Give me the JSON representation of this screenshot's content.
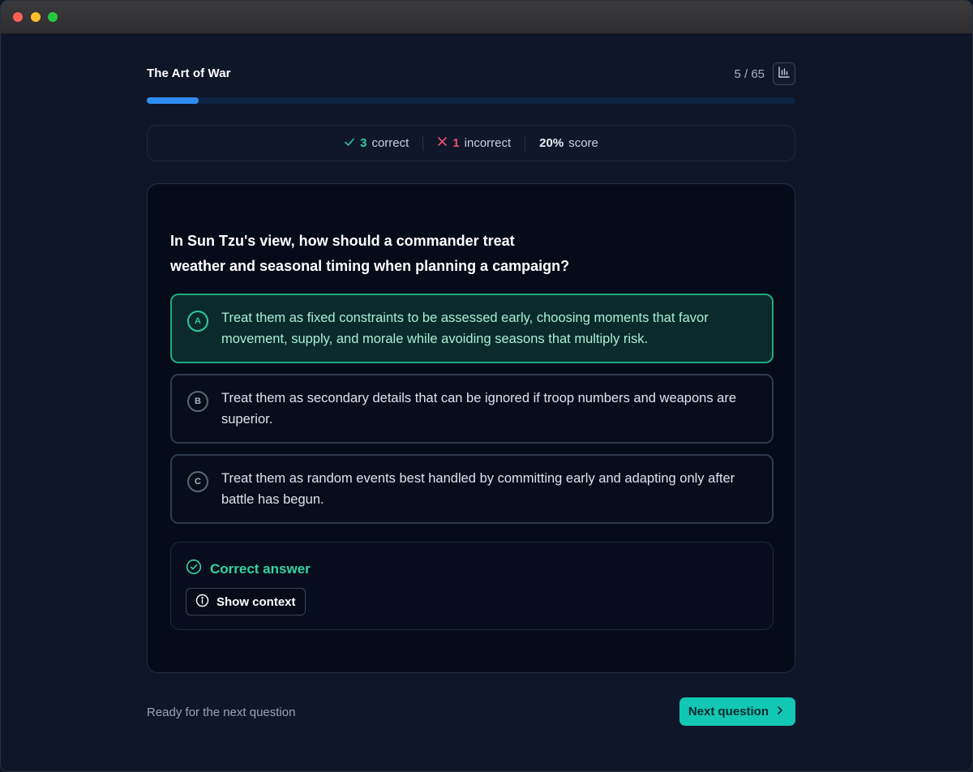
{
  "quiz": {
    "title": "The Art of War",
    "progress_text": "5 / 65",
    "progress_fraction": 0.08
  },
  "stats": {
    "correct_count": "3",
    "correct_label": "correct",
    "incorrect_count": "1",
    "incorrect_label": "incorrect",
    "score_value": "20%",
    "score_label": "score"
  },
  "question": {
    "text_line1": "In Sun Tzu's view, how should a commander treat",
    "text_line2": "weather and seasonal timing when planning a campaign?"
  },
  "options": [
    {
      "letter": "A",
      "text": "Treat them as fixed constraints to be assessed early, choosing moments that favor movement, supply, and morale while avoiding seasons that multiply risk.",
      "state": "correct"
    },
    {
      "letter": "B",
      "text": "Treat them as secondary details that can be ignored if troop numbers and weapons are superior.",
      "state": "default"
    },
    {
      "letter": "C",
      "text": "Treat them as random events best handled by committing early and adapting only after battle has begun.",
      "state": "default"
    }
  ],
  "feedback": {
    "title": "Correct answer",
    "context_button": "Show context"
  },
  "footer": {
    "status_text": "Ready for the next question",
    "next_button": "Next question"
  },
  "icons": {
    "stats": "bar-chart-icon",
    "correct": "check-icon",
    "incorrect": "x-icon",
    "feedback": "check-circle-icon",
    "context": "info-icon",
    "next": "chevron-right-icon"
  },
  "colors": {
    "accent_green": "#2ec99a",
    "accent_red": "#f0506e",
    "progress_blue": "#2f8cf0",
    "next_button": "#12c7b4"
  }
}
